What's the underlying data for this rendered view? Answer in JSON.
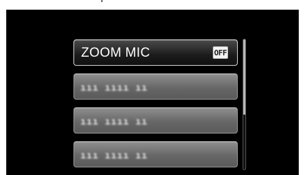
{
  "menu": {
    "items": [
      {
        "label": "ZOOM MIC",
        "value": "OFF",
        "selected": true
      },
      {
        "label": "ııı ıııı ıı",
        "blurred": true
      },
      {
        "label": "ııı ıııı ıı",
        "blurred": true
      },
      {
        "label": "ııı ıııı ıı",
        "blurred": true
      }
    ]
  },
  "scrollbar": {
    "position": 0.0,
    "visible_fraction": 0.58
  }
}
